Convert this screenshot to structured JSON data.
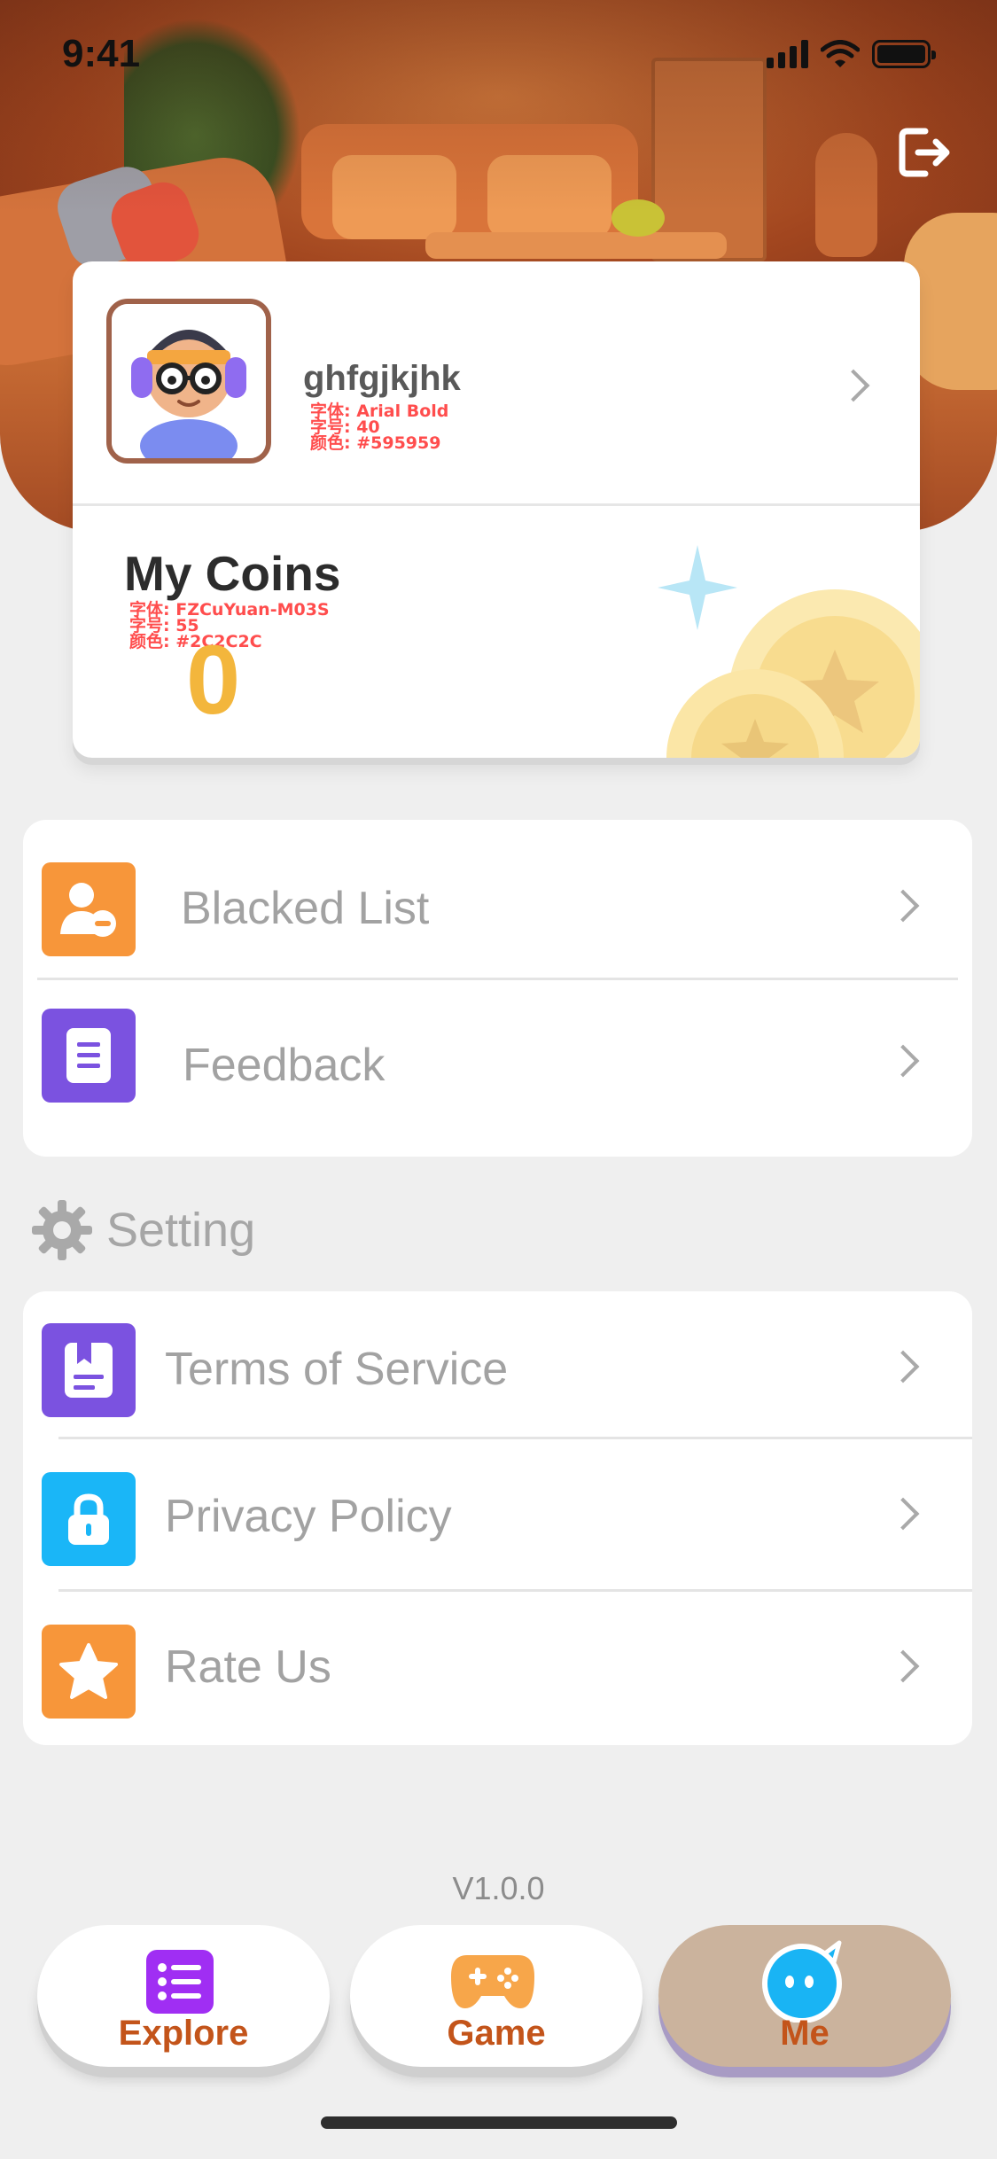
{
  "status_bar": {
    "time": "9:41"
  },
  "profile": {
    "username": "ghfgjkjhk",
    "username_annotation": [
      "字体: Arial Bold",
      "字号: 40",
      "颜色: #595959"
    ]
  },
  "coins": {
    "title": "My Coins",
    "title_annotation": [
      "字体: FZCuYuan-M03S",
      "字号: 55",
      "颜色: #2C2C2C"
    ],
    "value": "0"
  },
  "menu_primary": [
    {
      "label": "Blacked List",
      "icon": "user-block-icon",
      "color": "#f7963a"
    },
    {
      "label": "Feedback",
      "icon": "document-icon",
      "color": "#7b52e0"
    }
  ],
  "setting": {
    "title": "Setting",
    "items": [
      {
        "label": "Terms of Service",
        "icon": "bookmark-document-icon",
        "color": "#7b52e0"
      },
      {
        "label": "Privacy Policy",
        "icon": "lock-icon",
        "color": "#1ab6f7"
      },
      {
        "label": "Rate Us",
        "icon": "star-icon",
        "color": "#f7963a"
      }
    ]
  },
  "version": "V1.0.0",
  "tabs": [
    {
      "label": "Explore",
      "icon": "list-icon",
      "active": false
    },
    {
      "label": "Game",
      "icon": "gamepad-icon",
      "active": false
    },
    {
      "label": "Me",
      "icon": "chat-face-icon",
      "active": true
    }
  ],
  "colors": {
    "accent_orange": "#f7963a",
    "accent_purple": "#7b52e0",
    "accent_blue": "#1ab6f7",
    "coin_gold": "#f3b63c",
    "tab_label": "#c3541a"
  }
}
